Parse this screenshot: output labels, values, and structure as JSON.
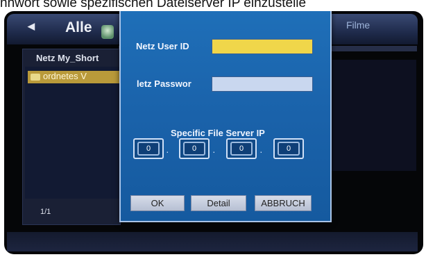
{
  "caption": "nnwort sowie spezifischen Dateiserver IP einzustelle",
  "header": {
    "tab_left": "Alle",
    "tab_right": "Filme"
  },
  "browser": {
    "path": "Netz  My_Short",
    "selected_item": "ordnetes V",
    "pager": "1/1"
  },
  "dialog": {
    "user_id_label": "Netz User ID",
    "user_id_value": "",
    "password_label": "letz Passwor",
    "password_value": "",
    "ip_section_title": "Specific File Server IP",
    "ip_octets": [
      "0",
      "0",
      "0",
      "0"
    ],
    "buttons": {
      "ok": "OK",
      "detail": "Detail",
      "cancel": "ABBRUCH"
    }
  },
  "colors": {
    "dialog_bg": "#1a62aa",
    "user_id_field_bg": "#f0d64a",
    "password_field_bg": "#c9d7ef",
    "selection_bg": "#b99a3a"
  }
}
